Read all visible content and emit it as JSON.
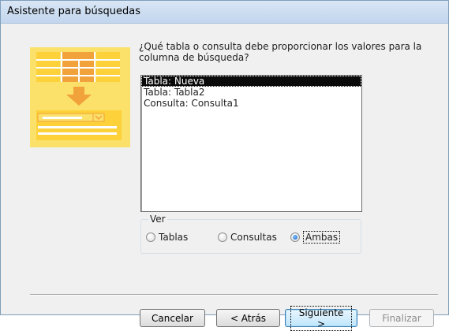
{
  "window": {
    "title": "Asistente para búsquedas"
  },
  "prompt": "¿Qué tabla o consulta debe proporcionar los valores para la columna de búsqueda?",
  "list": {
    "items": [
      "Tabla: Nueva",
      "Tabla: Tabla2",
      "Consulta: Consulta1"
    ],
    "selected_index": 0
  },
  "view": {
    "label": "Ver",
    "options": [
      "Tablas",
      "Consultas",
      "Ambas"
    ],
    "selected": "Ambas"
  },
  "buttons": {
    "cancel": "Cancelar",
    "back": "< Atrás",
    "next": "Siguiente >",
    "finish": "Finalizar"
  },
  "colors": {
    "illustration_yellow": "#fbe06a",
    "illustration_orange": "#f2a23a",
    "selection": "#0a0a0a"
  },
  "icons": {
    "illustration": "table-lookup-wizard-illustration"
  }
}
